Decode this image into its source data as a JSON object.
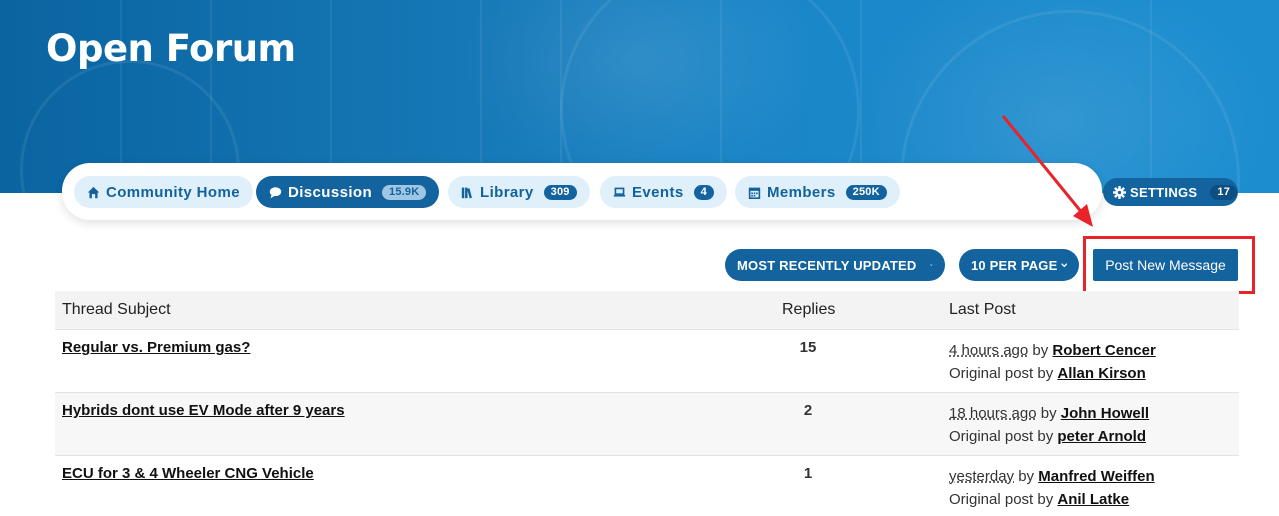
{
  "header": {
    "title": "Open Forum"
  },
  "nav": {
    "items": [
      {
        "label": "Community Home",
        "count": "",
        "icon": "home-icon"
      },
      {
        "label": "Discussion",
        "count": "15.9K",
        "icon": "chat-bubble-icon"
      },
      {
        "label": "Library",
        "count": "309",
        "icon": "books-icon"
      },
      {
        "label": "Events",
        "count": "4",
        "icon": "laptop-icon"
      },
      {
        "label": "Members",
        "count": "250K",
        "icon": "calendar-icon"
      }
    ],
    "active_item": "Discussion"
  },
  "settings": {
    "label": "SETTINGS",
    "count": "17",
    "icon": "gear-icon"
  },
  "toolbar": {
    "sort_label": "MOST RECENTLY UPDATED",
    "per_page_label": "10 PER PAGE",
    "post_button_label": "Post New Message"
  },
  "table": {
    "columns": {
      "subject": "Thread Subject",
      "replies": "Replies",
      "last_post": "Last Post"
    },
    "rows": [
      {
        "subject": "Regular vs. Premium gas?",
        "replies": "15",
        "last_time": "4 hours ago",
        "by_label": "by",
        "last_author": "Robert Cencer",
        "original_label": "Original post by",
        "original_author": "Allan Kirson"
      },
      {
        "subject": "Hybrids dont use EV Mode after 9 years",
        "replies": "2",
        "last_time": "18 hours ago",
        "by_label": "by",
        "last_author": "John Howell",
        "original_label": "Original post by",
        "original_author": "peter Arnold"
      },
      {
        "subject": "ECU for 3 & 4 Wheeler CNG Vehicle",
        "replies": "1",
        "last_time": "yesterday",
        "by_label": "by",
        "last_author": "Manfred Weiffen",
        "original_label": "Original post by",
        "original_author": "Anil Latke"
      }
    ]
  },
  "colors": {
    "brand_blue": "#13639f",
    "pill_light": "#dff0fa",
    "highlight_red": "#e8232a"
  }
}
